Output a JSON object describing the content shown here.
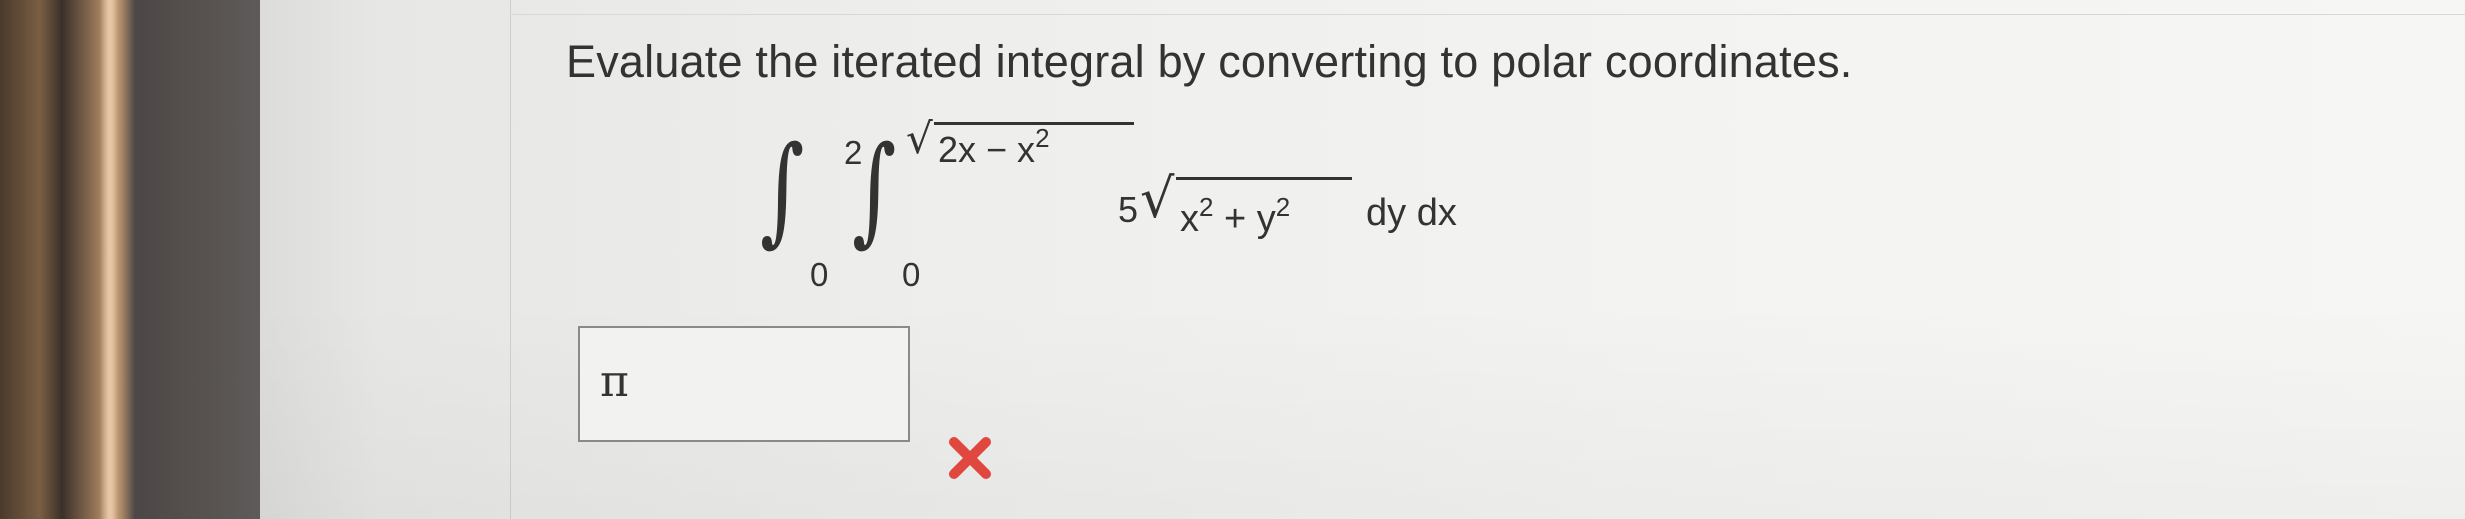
{
  "question": {
    "prompt": "Evaluate the iterated integral by converting to polar coordinates."
  },
  "integral": {
    "outer_lower": "0",
    "outer_upper": "2",
    "inner_lower": "0",
    "inner_upper_radicand": "2x − x",
    "inner_upper_exp": "2",
    "coefficient": "5",
    "integrand_radicand_a": "x",
    "integrand_exp_a": "2",
    "integrand_plus": " + y",
    "integrand_exp_b": "2",
    "differentials": "dy dx"
  },
  "answer": {
    "value": "π",
    "status": "incorrect",
    "status_icon": "red-x-icon",
    "status_color": "#e0473e"
  }
}
